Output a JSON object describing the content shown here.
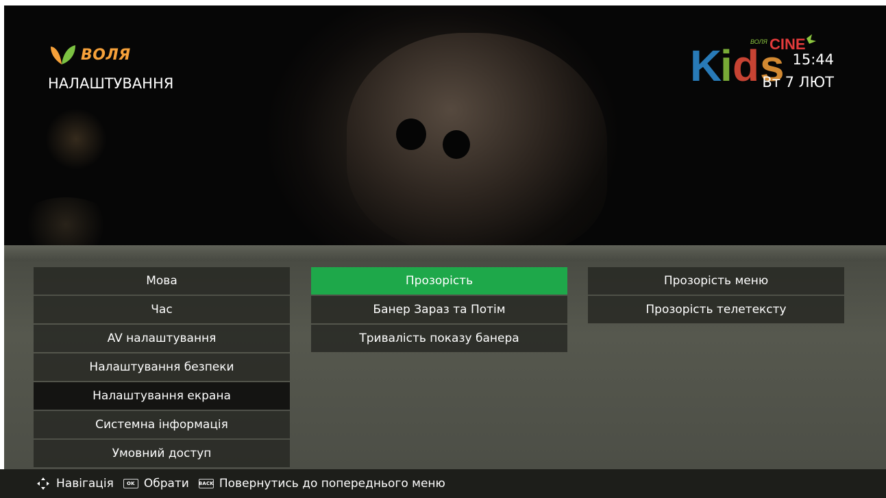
{
  "header": {
    "brand_name": "ВОЛЯ",
    "page_title": "НАЛАШТУВАННЯ",
    "time": "15:44",
    "date": "Вт 7 ЛЮТ"
  },
  "channel_logo": {
    "text_main": "Kids",
    "text_small": "ВОЛЯ",
    "text_cine": "CINE",
    "colors": {
      "K": "#2f8fd6",
      "i": "#8cc63f",
      "d": "#e94e3c",
      "s": "#f6a13a",
      "cine": "#e33b3b"
    }
  },
  "menu": {
    "column1": [
      {
        "label": "Мова"
      },
      {
        "label": "Час"
      },
      {
        "label": "AV налаштування"
      },
      {
        "label": "Налаштування безпеки"
      },
      {
        "label": "Налаштування екрана",
        "state": "selected"
      },
      {
        "label": "Системна інформація"
      },
      {
        "label": "Умовний доступ"
      }
    ],
    "column2": [
      {
        "label": "Прозорість",
        "state": "active"
      },
      {
        "label": "Банер Зараз та Потім"
      },
      {
        "label": "Тривалість показу банера"
      }
    ],
    "column3": [
      {
        "label": "Прозорість меню"
      },
      {
        "label": "Прозорість телетексту"
      }
    ]
  },
  "footer": {
    "nav_label": "Навігація",
    "ok_key": "OK",
    "ok_label": "Обрати",
    "back_key": "BACK",
    "back_label": "Повернутись до попереднього меню"
  },
  "colors": {
    "accent_green": "#1ea84a",
    "brand_orange": "#f6a13a",
    "brand_leaf_green": "#7cc242"
  },
  "icons": [
    "brand-leaf-icon",
    "navigation-arrows-icon",
    "ok-key-icon",
    "back-key-icon"
  ]
}
